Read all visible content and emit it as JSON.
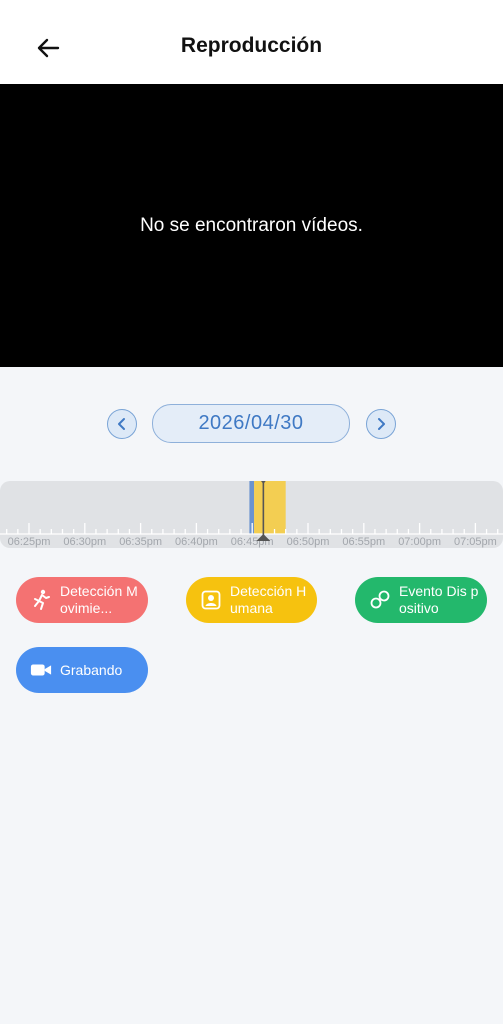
{
  "header": {
    "title": "Reproducción",
    "back_icon": "arrow-left-icon"
  },
  "player": {
    "message": "No se encontraron vídeos."
  },
  "date_nav": {
    "date": "2026/04/30",
    "prev_icon": "chevron-left-icon",
    "next_icon": "chevron-right-icon"
  },
  "timeline": {
    "labels": [
      "06:25pm",
      "06:30pm",
      "06:35pm",
      "06:40pm",
      "06:45pm",
      "06:50pm",
      "06:55pm",
      "07:00pm",
      "07:05pm"
    ],
    "segments": [
      {
        "type": "motion",
        "color": "#6b93cf",
        "start": "06:44:45pm",
        "end": "06:45:10pm"
      },
      {
        "type": "human",
        "color": "#f3ce52",
        "start": "06:45:10pm",
        "end": "06:48:00pm"
      }
    ],
    "cursor_time": "06:46pm",
    "cursor_color": "#555555",
    "track_color": "#e0e2e5"
  },
  "legend": [
    {
      "label": "Detección Movimie...",
      "color": "#f47272",
      "icon": "running-person-icon"
    },
    {
      "label": "Detección Humana",
      "color": "#f6c20f",
      "icon": "person-frame-icon"
    },
    {
      "label": "Evento Dis positivo",
      "color": "#23b86c",
      "icon": "device-link-icon"
    },
    {
      "label": "Grabando",
      "color": "#4a8ff0",
      "icon": "video-camera-icon"
    }
  ]
}
